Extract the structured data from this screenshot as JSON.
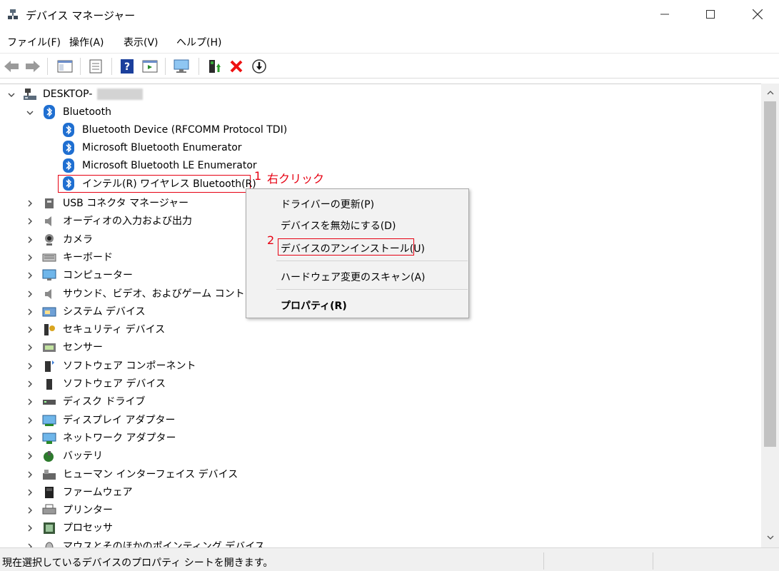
{
  "window": {
    "title": "デバイス マネージャー",
    "minimize_icon": "minimize-icon",
    "maximize_icon": "maximize-icon",
    "close_icon": "close-icon"
  },
  "menu": [
    "ファイル(F)",
    "操作(A)",
    "表示(V)",
    "ヘルプ(H)"
  ],
  "toolbar": {
    "icons": [
      "back-arrow-icon",
      "forward-arrow-icon",
      "show-hide-console-tree-icon",
      "properties-icon",
      "help-icon",
      "action-pane-icon",
      "scan-hardware-icon",
      "update-driver-icon",
      "uninstall-device-icon",
      "disable-device-icon"
    ]
  },
  "tree": {
    "root": "DESKTOP-",
    "bluetooth_category": "Bluetooth",
    "bluetooth_children": [
      "Bluetooth Device (RFCOMM Protocol TDI)",
      "Microsoft Bluetooth Enumerator",
      "Microsoft Bluetooth LE Enumerator",
      "インテル(R) ワイヤレス Bluetooth(R)"
    ],
    "categories": [
      "USB コネクタ マネージャー",
      "オーディオの入力および出力",
      "カメラ",
      "キーボード",
      "コンピューター",
      "サウンド、ビデオ、およびゲーム コントローラー",
      "システム デバイス",
      "セキュリティ デバイス",
      "センサー",
      "ソフトウェア コンポーネント",
      "ソフトウェア デバイス",
      "ディスク ドライブ",
      "ディスプレイ アダプター",
      "ネットワーク アダプター",
      "バッテリ",
      "ヒューマン インターフェイス デバイス",
      "ファームウェア",
      "プリンター",
      "プロセッサ",
      "マウスとそのほかのポインティング デバイス"
    ]
  },
  "context_menu": {
    "update_driver": "ドライバーの更新(P)",
    "disable_device": "デバイスを無効にする(D)",
    "uninstall_device": "デバイスのアンインストール(U)",
    "scan_hardware": "ハードウェア変更のスキャン(A)",
    "properties": "プロパティ(R)"
  },
  "annotations": {
    "step1_number": "1",
    "step1_text": "右クリック",
    "step2_number": "2"
  },
  "status": {
    "text": "現在選択しているデバイスのプロパティ シートを開きます。"
  },
  "colors": {
    "annotation_red": "#e60012",
    "bluetooth_blue": "#1f6fd1"
  }
}
